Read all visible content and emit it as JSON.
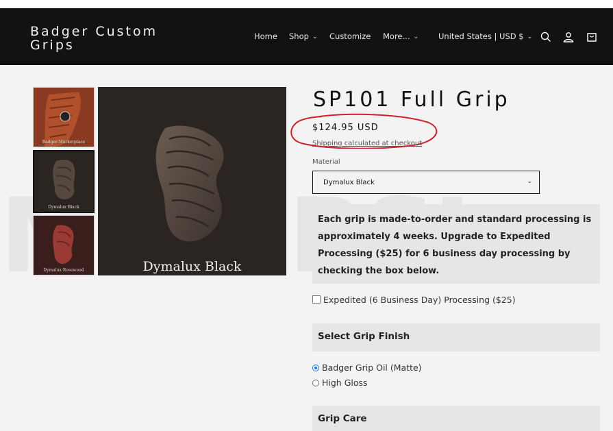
{
  "header": {
    "brand": "Badger Custom Grips",
    "nav": [
      {
        "label": "Home"
      },
      {
        "label": "Shop"
      },
      {
        "label": "Customize"
      },
      {
        "label": "More..."
      }
    ],
    "locale": "United States | USD $",
    "icons": [
      "search-icon",
      "account-icon",
      "cart-icon"
    ],
    "background_color": "#121212"
  },
  "watermark": "MOVIRSI",
  "gallery": {
    "thumbnails": [
      {
        "caption": "Badger Marketplace",
        "color": "#8a3a22"
      },
      {
        "caption": "Dymalux Black",
        "color": "#2b2522",
        "selected": true
      },
      {
        "caption": "Dymalux Rosewood",
        "color": "#3a1e1c"
      }
    ],
    "main_caption": "Dymalux Black"
  },
  "product": {
    "title": "SP101 Full Grip",
    "price": "$124.95 USD",
    "shipping_note": "Shipping calculated at checkout",
    "material_label": "Material",
    "material_value": "Dymalux Black",
    "notice": "Each grip is made-to-order and standard processing is approximately 4 weeks. Upgrade to Expedited Processing ($25) for 6 business day processing by checking the box below.",
    "expedited_label": "Expedited (6 Business Day) Processing ($25)",
    "finish_heading": "Select Grip Finish",
    "finish_options": [
      {
        "label": "Badger Grip Oil (Matte)",
        "selected": true
      },
      {
        "label": "High Gloss",
        "selected": false
      }
    ],
    "care_heading": "Grip Care"
  },
  "annotation_color": "#d0202a"
}
